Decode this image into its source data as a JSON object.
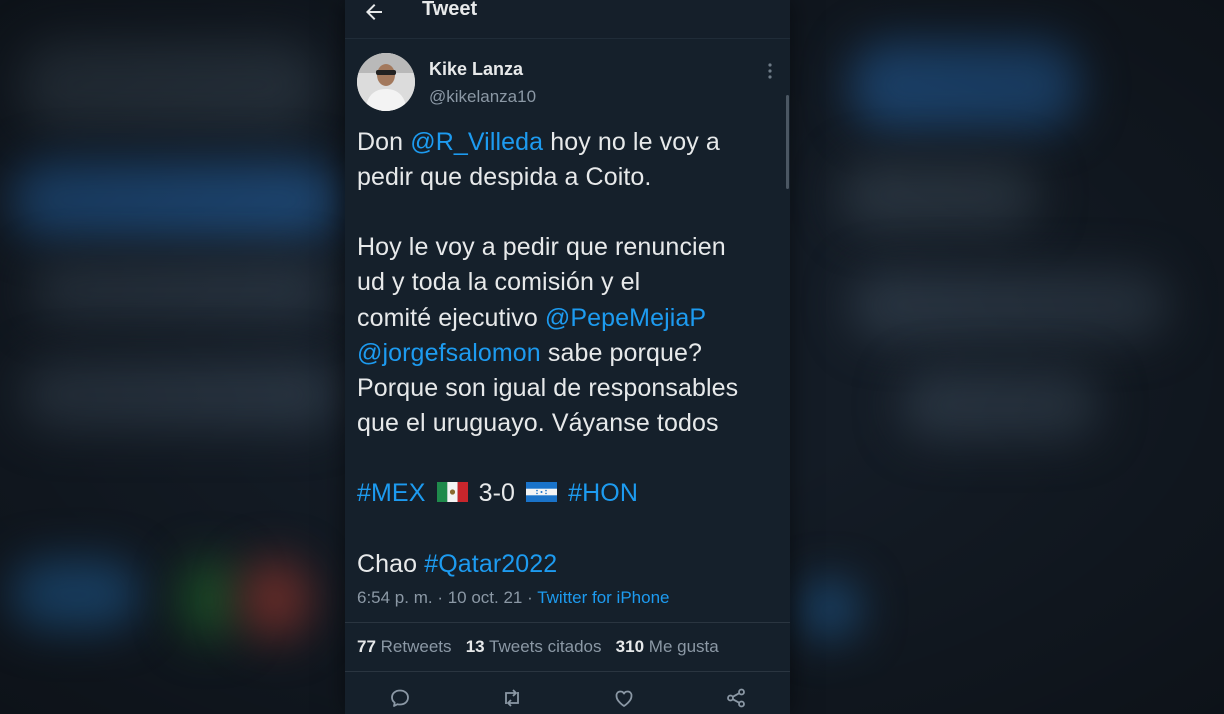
{
  "header": {
    "title": "Tweet",
    "back_icon": "arrow-left-icon"
  },
  "author": {
    "name": "Kike Lanza",
    "handle": "@kikelanza10"
  },
  "tweet": {
    "line1": {
      "pre": "Don ",
      "mention": "@R_Villeda",
      "post": " hoy no le voy a"
    },
    "line2": "pedir que despida a Coito.",
    "line3": "Hoy le voy a pedir que renuncien",
    "line4": "ud y toda la comisión y el",
    "line5": {
      "pre": "comité ejecutivo ",
      "mention": "@PepeMejiaP"
    },
    "line6": {
      "mention": "@jorgefsalomon",
      "post": " sabe porque?"
    },
    "line7": "Porque son igual de responsables",
    "line8": "que el uruguayo. Váyanse todos",
    "score": {
      "tag1": "#MEX",
      "result": "3-0",
      "tag2": "#HON",
      "flag1": "mexico-flag",
      "flag2": "honduras-flag"
    },
    "chao": {
      "pre": "Chao ",
      "tag": "#Qatar2022"
    }
  },
  "meta": {
    "time": "6:54 p. m.",
    "sep": " · ",
    "date": "10 oct. 21",
    "source": "Twitter for iPhone"
  },
  "stats": {
    "retweets_count": "77",
    "retweets_label": "Retweets",
    "quotes_count": "13",
    "quotes_label": "Tweets citados",
    "likes_count": "310",
    "likes_label": "Me gusta"
  },
  "actions": [
    "reply-icon",
    "retweet-icon",
    "like-icon",
    "share-icon"
  ],
  "colors": {
    "background": "#15202b",
    "accent": "#1d9bf0",
    "text": "#e7e9ea",
    "muted": "#8b98a5"
  }
}
